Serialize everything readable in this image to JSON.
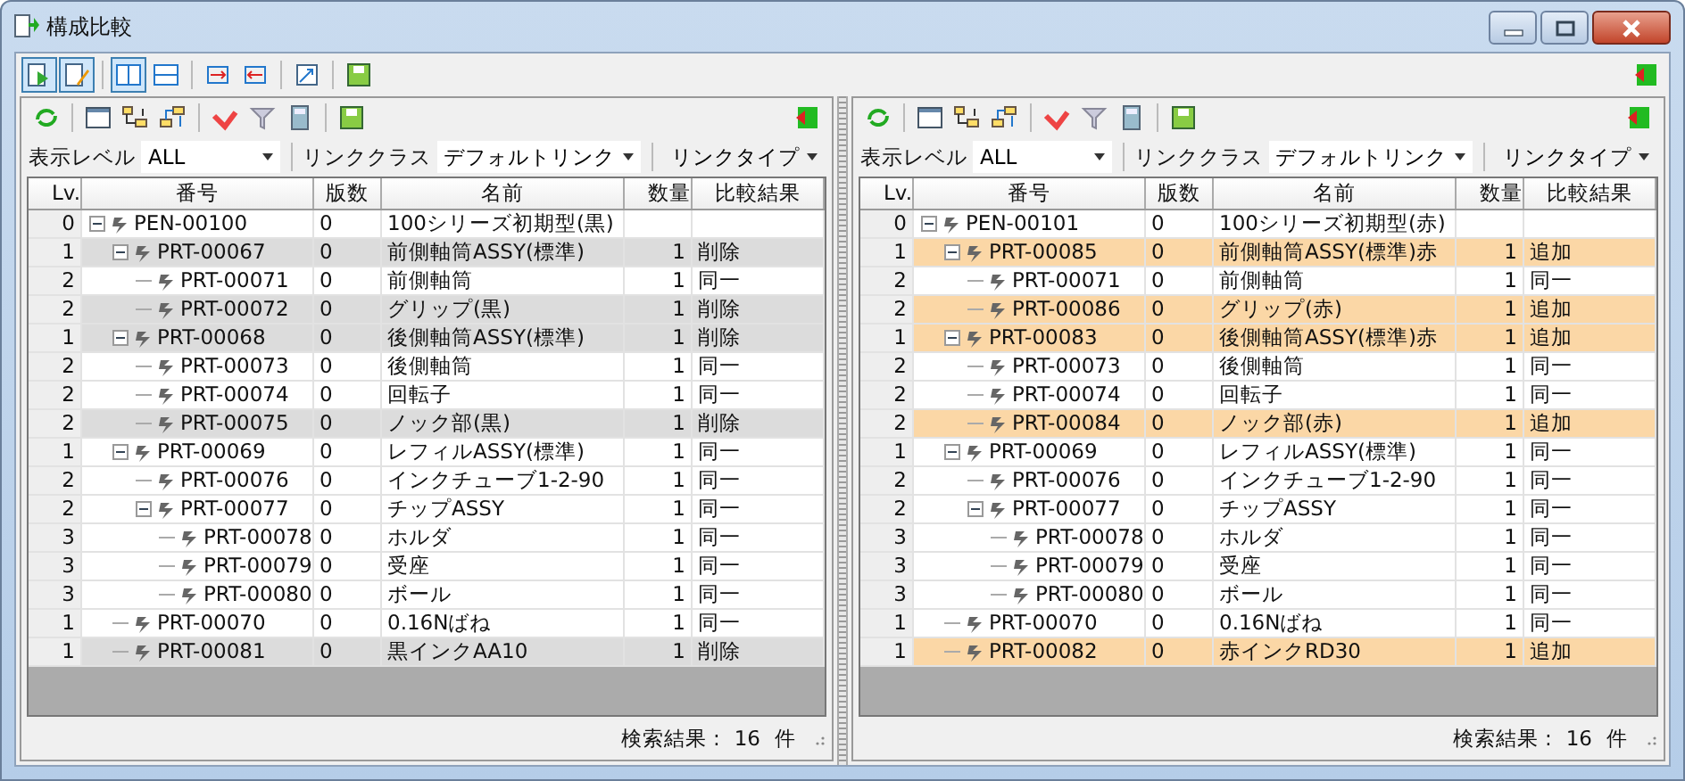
{
  "window": {
    "title": "構成比較"
  },
  "panels": [
    {
      "filters": {
        "level_label": "表示レベル",
        "level_value": "ALL",
        "class_label": "リンククラス",
        "class_value": "デフォルトリンク",
        "type_label": "リンクタイプ"
      },
      "columns": [
        "Lv.",
        "番号",
        "版数",
        "名前",
        "数量",
        "比較結果"
      ],
      "rows": [
        {
          "lv": "0",
          "number": "PEN-00100",
          "version": "0",
          "name": "100シリーズ初期型(黒)",
          "kind": "same",
          "expanded": true,
          "children": [
            {
              "lv": "1",
              "number": "PRT-00067",
              "version": "0",
              "name": "前側軸筒ASSY(標準)",
              "qty": "1",
              "result": "削除",
              "kind": "deleted",
              "expanded": true,
              "children": [
                {
                  "lv": "2",
                  "number": "PRT-00071",
                  "version": "0",
                  "name": "前側軸筒",
                  "qty": "1",
                  "result": "同一",
                  "kind": "same"
                },
                {
                  "lv": "2",
                  "number": "PRT-00072",
                  "version": "0",
                  "name": "グリップ(黒)",
                  "qty": "1",
                  "result": "削除",
                  "kind": "deleted"
                }
              ]
            },
            {
              "lv": "1",
              "number": "PRT-00068",
              "version": "0",
              "name": "後側軸筒ASSY(標準)",
              "qty": "1",
              "result": "削除",
              "kind": "deleted",
              "expanded": true,
              "children": [
                {
                  "lv": "2",
                  "number": "PRT-00073",
                  "version": "0",
                  "name": "後側軸筒",
                  "qty": "1",
                  "result": "同一",
                  "kind": "same"
                },
                {
                  "lv": "2",
                  "number": "PRT-00074",
                  "version": "0",
                  "name": "回転子",
                  "qty": "1",
                  "result": "同一",
                  "kind": "same"
                },
                {
                  "lv": "2",
                  "number": "PRT-00075",
                  "version": "0",
                  "name": "ノック部(黒)",
                  "qty": "1",
                  "result": "削除",
                  "kind": "deleted"
                }
              ]
            },
            {
              "lv": "1",
              "number": "PRT-00069",
              "version": "0",
              "name": "レフィルASSY(標準)",
              "qty": "1",
              "result": "同一",
              "kind": "same",
              "expanded": true,
              "children": [
                {
                  "lv": "2",
                  "number": "PRT-00076",
                  "version": "0",
                  "name": "インクチューブ1-2-90",
                  "qty": "1",
                  "result": "同一",
                  "kind": "same"
                },
                {
                  "lv": "2",
                  "number": "PRT-00077",
                  "version": "0",
                  "name": "チップASSY",
                  "qty": "1",
                  "result": "同一",
                  "kind": "same",
                  "expanded": true,
                  "children": [
                    {
                      "lv": "3",
                      "number": "PRT-00078",
                      "version": "0",
                      "name": "ホルダ",
                      "qty": "1",
                      "result": "同一",
                      "kind": "same"
                    },
                    {
                      "lv": "3",
                      "number": "PRT-00079",
                      "version": "0",
                      "name": "受座",
                      "qty": "1",
                      "result": "同一",
                      "kind": "same"
                    },
                    {
                      "lv": "3",
                      "number": "PRT-00080",
                      "version": "0",
                      "name": "ボール",
                      "qty": "1",
                      "result": "同一",
                      "kind": "same"
                    }
                  ]
                }
              ]
            },
            {
              "lv": "1",
              "number": "PRT-00070",
              "version": "0",
              "name": "0.16Nばね",
              "qty": "1",
              "result": "同一",
              "kind": "same"
            },
            {
              "lv": "1",
              "number": "PRT-00081",
              "version": "0",
              "name": "黒インクAA10",
              "qty": "1",
              "result": "削除",
              "kind": "deleted"
            }
          ]
        }
      ],
      "status": {
        "label": "検索結果 :",
        "count": "16",
        "unit": "件"
      }
    },
    {
      "filters": {
        "level_label": "表示レベル",
        "level_value": "ALL",
        "class_label": "リンククラス",
        "class_value": "デフォルトリンク",
        "type_label": "リンクタイプ"
      },
      "columns": [
        "Lv.",
        "番号",
        "版数",
        "名前",
        "数量",
        "比較結果"
      ],
      "rows": [
        {
          "lv": "0",
          "number": "PEN-00101",
          "version": "0",
          "name": "100シリーズ初期型(赤)",
          "kind": "same",
          "expanded": true,
          "children": [
            {
              "lv": "1",
              "number": "PRT-00085",
              "version": "0",
              "name": "前側軸筒ASSY(標準)赤",
              "qty": "1",
              "result": "追加",
              "kind": "added",
              "expanded": true,
              "children": [
                {
                  "lv": "2",
                  "number": "PRT-00071",
                  "version": "0",
                  "name": "前側軸筒",
                  "qty": "1",
                  "result": "同一",
                  "kind": "same"
                },
                {
                  "lv": "2",
                  "number": "PRT-00086",
                  "version": "0",
                  "name": "グリップ(赤)",
                  "qty": "1",
                  "result": "追加",
                  "kind": "added"
                }
              ]
            },
            {
              "lv": "1",
              "number": "PRT-00083",
              "version": "0",
              "name": "後側軸筒ASSY(標準)赤",
              "qty": "1",
              "result": "追加",
              "kind": "added",
              "expanded": true,
              "children": [
                {
                  "lv": "2",
                  "number": "PRT-00073",
                  "version": "0",
                  "name": "後側軸筒",
                  "qty": "1",
                  "result": "同一",
                  "kind": "same"
                },
                {
                  "lv": "2",
                  "number": "PRT-00074",
                  "version": "0",
                  "name": "回転子",
                  "qty": "1",
                  "result": "同一",
                  "kind": "same"
                },
                {
                  "lv": "2",
                  "number": "PRT-00084",
                  "version": "0",
                  "name": "ノック部(赤)",
                  "qty": "1",
                  "result": "追加",
                  "kind": "added"
                }
              ]
            },
            {
              "lv": "1",
              "number": "PRT-00069",
              "version": "0",
              "name": "レフィルASSY(標準)",
              "qty": "1",
              "result": "同一",
              "kind": "same",
              "expanded": true,
              "children": [
                {
                  "lv": "2",
                  "number": "PRT-00076",
                  "version": "0",
                  "name": "インクチューブ1-2-90",
                  "qty": "1",
                  "result": "同一",
                  "kind": "same"
                },
                {
                  "lv": "2",
                  "number": "PRT-00077",
                  "version": "0",
                  "name": "チップASSY",
                  "qty": "1",
                  "result": "同一",
                  "kind": "same",
                  "expanded": true,
                  "children": [
                    {
                      "lv": "3",
                      "number": "PRT-00078",
                      "version": "0",
                      "name": "ホルダ",
                      "qty": "1",
                      "result": "同一",
                      "kind": "same"
                    },
                    {
                      "lv": "3",
                      "number": "PRT-00079",
                      "version": "0",
                      "name": "受座",
                      "qty": "1",
                      "result": "同一",
                      "kind": "same"
                    },
                    {
                      "lv": "3",
                      "number": "PRT-00080",
                      "version": "0",
                      "name": "ボール",
                      "qty": "1",
                      "result": "同一",
                      "kind": "same"
                    }
                  ]
                }
              ]
            },
            {
              "lv": "1",
              "number": "PRT-00070",
              "version": "0",
              "name": "0.16Nばね",
              "qty": "1",
              "result": "同一",
              "kind": "same"
            },
            {
              "lv": "1",
              "number": "PRT-00082",
              "version": "0",
              "name": "赤インクRD30",
              "qty": "1",
              "result": "追加",
              "kind": "added"
            }
          ]
        }
      ],
      "status": {
        "label": "検索結果 :",
        "count": "16",
        "unit": "件"
      }
    }
  ]
}
